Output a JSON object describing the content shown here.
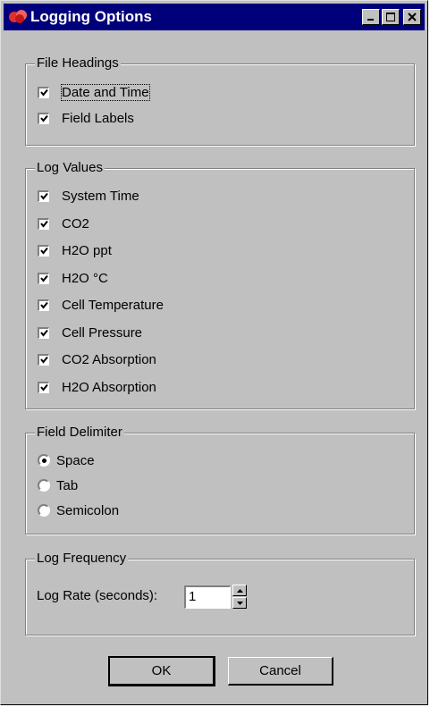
{
  "window": {
    "title": "Logging Options"
  },
  "file_headings": {
    "legend": "File Headings",
    "items": [
      {
        "label": "Date and Time",
        "checked": true
      },
      {
        "label": "Field Labels",
        "checked": true
      }
    ]
  },
  "log_values": {
    "legend": "Log Values",
    "items": [
      {
        "label": "System Time",
        "checked": true
      },
      {
        "label": "CO2",
        "checked": true
      },
      {
        "label": "H2O ppt",
        "checked": true
      },
      {
        "label": "H2O °C",
        "checked": true
      },
      {
        "label": "Cell Temperature",
        "checked": true
      },
      {
        "label": "Cell Pressure",
        "checked": true
      },
      {
        "label": "CO2 Absorption",
        "checked": true
      },
      {
        "label": "H2O Absorption",
        "checked": true
      }
    ]
  },
  "field_delimiter": {
    "legend": "Field Delimiter",
    "options": [
      {
        "label": "Space",
        "selected": true
      },
      {
        "label": "Tab",
        "selected": false
      },
      {
        "label": "Semicolon",
        "selected": false
      }
    ]
  },
  "log_frequency": {
    "legend": "Log Frequency",
    "rate_label": "Log Rate (seconds):",
    "rate_value": "1"
  },
  "buttons": {
    "ok": "OK",
    "cancel": "Cancel"
  }
}
